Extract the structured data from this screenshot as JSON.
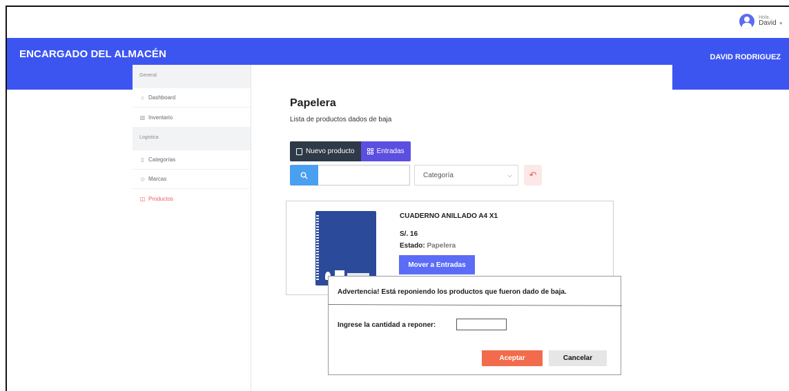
{
  "topbar": {
    "greeting": "Hola.",
    "user_short": "David",
    "caret": "▾"
  },
  "header": {
    "role_title": "ENCARGADO DEL ALMACÉN",
    "user_full": "DAVID RODRIGUEZ"
  },
  "sidebar": {
    "section_general": "General",
    "item_dashboard": "Dashboard",
    "item_inventario": "Inventario",
    "section_logistica": "Logistica",
    "item_categorias": "Categorías",
    "item_marcas": "Marcas",
    "item_productos": "Productos"
  },
  "page": {
    "title": "Papelera",
    "subtitle": "Lista de productos dados de baja"
  },
  "toolbar": {
    "new_product": "Nuevo producto",
    "entradas": "Entradas"
  },
  "filters": {
    "search_value": "",
    "category_value": "Categoría"
  },
  "product": {
    "name": "CUADERNO ANILLADO A4 X1",
    "price": "S/. 16",
    "state_label": "Estado:",
    "state_value": "Papelera",
    "move_button": "Mover a Entradas"
  },
  "modal": {
    "warning": "Advertencia! Está reponiendo los productos que fueron dado de baja.",
    "qty_label": "Ingrese la cantidad a reponer:",
    "qty_value": "",
    "accept": "Aceptar",
    "cancel": "Cancelar"
  },
  "colors": {
    "accent": "#3d55f0",
    "active_nav": "#ef5a5a",
    "accept": "#f26b4c"
  }
}
